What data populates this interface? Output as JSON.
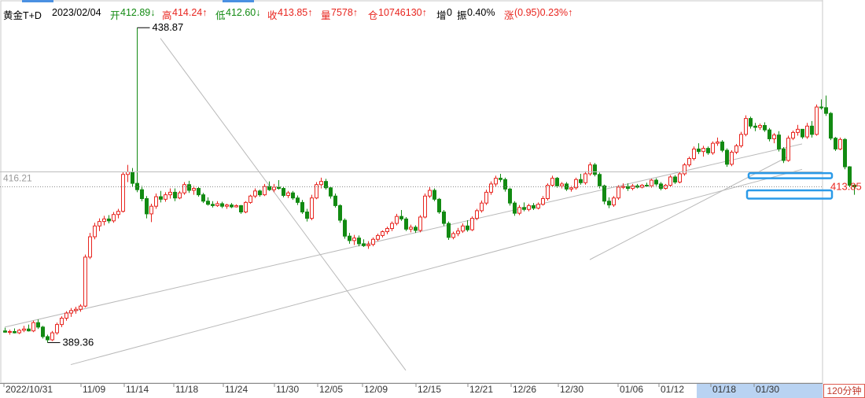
{
  "header": {
    "name": "黄金T+D",
    "date": "2023/02/04",
    "open_label": "开",
    "open": "412.89↓",
    "high_label": "高",
    "high": "414.24↑",
    "low_label": "低",
    "low": "412.60↓",
    "close_label": "收",
    "close": "413.85↑",
    "volume_label": "量",
    "volume": "7578↑",
    "oi_label": "仓",
    "oi": "10746130↑",
    "increase_label": "增",
    "increase": "0",
    "amplitude_label": "振",
    "amplitude": "0.40%",
    "change_label": "涨",
    "change": "(0.95)0.23%↑"
  },
  "period_button": "120分钟",
  "colors": {
    "up": "#e8251f",
    "down": "#128a12",
    "channel": "#b9b9b9",
    "highlight_box": "#2b9ae8",
    "axis_bg": "#b9d3f2",
    "header_red": "#e8251f",
    "header_green": "#128a12"
  },
  "chart_data": {
    "type": "candlestick",
    "title": "黄金T+D",
    "interval": "120分钟",
    "ylim": [
      383,
      441
    ],
    "x_tick_labels": [
      "2022/10/31",
      "11/09",
      "11/14",
      "11/18",
      "11/24",
      "11/30",
      "12/05",
      "12/09",
      "12/15",
      "12/21",
      "12/26",
      "12/30",
      "01/06",
      "01/12",
      "01/18",
      "01/30"
    ],
    "annotations": {
      "max": "438.87",
      "min": "389.36",
      "crosshair_price": "416.21",
      "last_price": "413.85"
    },
    "trend_lines": [
      {
        "name": "channel-upper",
        "from": [
          0,
          391.8
        ],
        "to": [
          169,
          420.6
        ]
      },
      {
        "name": "channel-lower",
        "from": [
          14,
          385.9
        ],
        "to": [
          169,
          416.6
        ]
      },
      {
        "name": "channel-inner",
        "from": [
          124,
          402.4
        ],
        "to": [
          166,
          418.6
        ]
      },
      {
        "name": "descending-line",
        "from": [
          33,
          437.2
        ],
        "to": [
          85,
          385.0
        ]
      }
    ],
    "highlight_zones": [
      {
        "name": "upper-box",
        "price_low": 415.2,
        "price_high": 416.0
      },
      {
        "name": "lower-box",
        "price_low": 412.0,
        "price_high": 413.3
      }
    ],
    "candles": [
      [
        391.2,
        391.7,
        390.9,
        391.0
      ],
      [
        391.0,
        391.4,
        390.6,
        391.1
      ],
      [
        391.1,
        391.6,
        390.8,
        390.9
      ],
      [
        390.9,
        391.5,
        390.7,
        391.3
      ],
      [
        391.3,
        392.0,
        391.0,
        391.5
      ],
      [
        391.5,
        392.2,
        391.1,
        391.2
      ],
      [
        391.2,
        392.8,
        391.0,
        392.5
      ],
      [
        392.5,
        393.0,
        391.5,
        391.8
      ],
      [
        391.8,
        392.0,
        390.0,
        390.3
      ],
      [
        390.3,
        390.6,
        389.36,
        389.8
      ],
      [
        389.8,
        391.2,
        389.6,
        390.9
      ],
      [
        390.9,
        392.5,
        390.6,
        392.2
      ],
      [
        392.2,
        393.5,
        391.8,
        393.2
      ],
      [
        393.2,
        394.3,
        392.8,
        394.0
      ],
      [
        394.0,
        394.8,
        393.4,
        394.4
      ],
      [
        394.4,
        395.0,
        393.9,
        394.6
      ],
      [
        394.6,
        395.4,
        394.2,
        395.1
      ],
      [
        395.1,
        403.2,
        394.9,
        402.8
      ],
      [
        402.8,
        406.6,
        402.5,
        406.0
      ],
      [
        406.0,
        408.2,
        405.6,
        407.7
      ],
      [
        407.7,
        408.9,
        406.9,
        408.4
      ],
      [
        408.4,
        409.3,
        407.8,
        408.8
      ],
      [
        408.8,
        409.4,
        408.1,
        408.5
      ],
      [
        408.5,
        409.9,
        408.2,
        409.5
      ],
      [
        409.5,
        410.4,
        408.9,
        410.0
      ],
      [
        410.0,
        416.2,
        409.8,
        415.8
      ],
      [
        415.8,
        417.3,
        414.6,
        416.2
      ],
      [
        416.2,
        416.8,
        413.9,
        414.4
      ],
      [
        414.4,
        438.87,
        413.0,
        413.4
      ],
      [
        413.4,
        414.0,
        411.6,
        412.0
      ],
      [
        412.0,
        412.4,
        408.9,
        409.6
      ],
      [
        409.6,
        411.2,
        408.3,
        410.8
      ],
      [
        410.8,
        412.8,
        410.4,
        412.3
      ],
      [
        412.3,
        413.2,
        411.4,
        411.9
      ],
      [
        411.9,
        413.0,
        411.5,
        412.6
      ],
      [
        412.6,
        413.6,
        412.0,
        413.0
      ],
      [
        413.0,
        413.6,
        411.6,
        412.1
      ],
      [
        412.1,
        413.2,
        411.9,
        412.9
      ],
      [
        412.9,
        414.6,
        412.6,
        414.2
      ],
      [
        414.2,
        414.8,
        412.9,
        413.3
      ],
      [
        413.3,
        414.0,
        412.6,
        413.6
      ],
      [
        413.6,
        413.9,
        412.3,
        412.6
      ],
      [
        412.6,
        412.9,
        411.3,
        411.6
      ],
      [
        411.6,
        412.2,
        410.9,
        411.1
      ],
      [
        411.1,
        411.6,
        410.6,
        410.9
      ],
      [
        410.9,
        411.6,
        410.7,
        411.2
      ],
      [
        411.2,
        411.5,
        410.5,
        410.8
      ],
      [
        410.8,
        411.2,
        410.4,
        411.0
      ],
      [
        411.0,
        411.3,
        410.5,
        410.7
      ],
      [
        410.7,
        411.1,
        410.6,
        410.9
      ],
      [
        410.9,
        411.0,
        409.6,
        409.9
      ],
      [
        409.9,
        411.6,
        409.7,
        411.4
      ],
      [
        411.4,
        412.6,
        411.2,
        412.4
      ],
      [
        412.4,
        413.6,
        412.1,
        413.2
      ],
      [
        413.2,
        413.4,
        412.3,
        412.6
      ],
      [
        412.6,
        414.3,
        412.4,
        413.9
      ],
      [
        413.9,
        414.7,
        413.2,
        413.4
      ],
      [
        413.4,
        414.3,
        413.0,
        413.8
      ],
      [
        413.8,
        414.9,
        413.4,
        413.6
      ],
      [
        413.6,
        413.8,
        412.2,
        412.5
      ],
      [
        412.5,
        413.2,
        412.1,
        412.9
      ],
      [
        412.9,
        413.2,
        411.8,
        412.1
      ],
      [
        412.1,
        412.5,
        411.0,
        411.4
      ],
      [
        411.4,
        411.8,
        409.6,
        409.9
      ],
      [
        409.9,
        410.4,
        408.4,
        408.9
      ],
      [
        408.9,
        412.6,
        408.6,
        412.1
      ],
      [
        412.1,
        414.6,
        411.9,
        414.2
      ],
      [
        414.2,
        415.3,
        413.6,
        414.7
      ],
      [
        414.7,
        415.1,
        413.4,
        413.7
      ],
      [
        413.7,
        413.9,
        412.0,
        412.4
      ],
      [
        412.4,
        412.8,
        410.6,
        410.9
      ],
      [
        410.9,
        411.1,
        408.2,
        408.6
      ],
      [
        408.6,
        408.9,
        405.7,
        406.1
      ],
      [
        406.1,
        406.6,
        404.9,
        405.4
      ],
      [
        405.4,
        406.3,
        404.7,
        405.8
      ],
      [
        405.8,
        406.2,
        404.5,
        404.9
      ],
      [
        404.9,
        405.6,
        404.4,
        404.6
      ],
      [
        404.6,
        405.3,
        404.1,
        404.8
      ],
      [
        404.8,
        405.9,
        404.5,
        405.6
      ],
      [
        405.6,
        406.5,
        405.3,
        406.2
      ],
      [
        406.2,
        407.0,
        405.9,
        406.8
      ],
      [
        406.8,
        407.6,
        406.4,
        407.3
      ],
      [
        407.3,
        408.4,
        406.9,
        408.1
      ],
      [
        408.1,
        409.6,
        407.8,
        409.2
      ],
      [
        409.2,
        410.2,
        408.5,
        408.8
      ],
      [
        408.8,
        409.1,
        406.9,
        407.2
      ],
      [
        407.2,
        407.9,
        406.7,
        407.5
      ],
      [
        407.5,
        407.8,
        406.6,
        407.0
      ],
      [
        407.0,
        409.4,
        406.7,
        409.1
      ],
      [
        409.1,
        412.8,
        408.9,
        412.4
      ],
      [
        412.4,
        413.9,
        412.1,
        413.3
      ],
      [
        413.3,
        413.6,
        411.6,
        411.9
      ],
      [
        411.9,
        412.1,
        409.6,
        409.9
      ],
      [
        409.9,
        410.2,
        407.7,
        408.1
      ],
      [
        408.1,
        408.4,
        405.5,
        405.9
      ],
      [
        405.9,
        406.8,
        405.6,
        406.5
      ],
      [
        406.5,
        407.4,
        406.1,
        406.9
      ],
      [
        406.9,
        408.1,
        406.6,
        407.7
      ],
      [
        407.7,
        408.6,
        406.8,
        407.1
      ],
      [
        407.1,
        409.2,
        406.9,
        408.9
      ],
      [
        408.9,
        410.4,
        408.6,
        410.1
      ],
      [
        410.1,
        411.7,
        409.8,
        411.3
      ],
      [
        411.3,
        413.4,
        411.0,
        413.0
      ],
      [
        413.0,
        414.7,
        412.6,
        414.3
      ],
      [
        414.3,
        415.6,
        413.9,
        415.2
      ],
      [
        415.2,
        415.9,
        414.6,
        415.0
      ],
      [
        415.0,
        415.3,
        413.1,
        413.5
      ],
      [
        413.5,
        413.7,
        410.9,
        411.3
      ],
      [
        411.3,
        411.6,
        409.3,
        409.7
      ],
      [
        409.7,
        411.0,
        409.4,
        410.6
      ],
      [
        410.6,
        411.4,
        410.0,
        410.3
      ],
      [
        410.3,
        411.2,
        410.0,
        410.9
      ],
      [
        410.9,
        411.3,
        410.2,
        410.5
      ],
      [
        410.5,
        411.4,
        410.3,
        411.1
      ],
      [
        411.1,
        412.4,
        410.9,
        412.0
      ],
      [
        412.0,
        414.4,
        411.7,
        414.1
      ],
      [
        414.1,
        415.6,
        413.8,
        415.2
      ],
      [
        415.2,
        415.4,
        413.7,
        414.0
      ],
      [
        414.0,
        414.6,
        413.6,
        414.3
      ],
      [
        414.3,
        414.6,
        413.2,
        413.5
      ],
      [
        413.5,
        414.0,
        413.1,
        413.7
      ],
      [
        413.7,
        415.3,
        413.4,
        415.0
      ],
      [
        415.0,
        415.9,
        414.2,
        414.5
      ],
      [
        414.5,
        416.3,
        414.2,
        415.9
      ],
      [
        415.9,
        417.7,
        415.6,
        417.3
      ],
      [
        417.3,
        417.6,
        415.5,
        415.8
      ],
      [
        415.8,
        416.1,
        413.6,
        414.0
      ],
      [
        414.0,
        414.2,
        411.1,
        411.6
      ],
      [
        411.6,
        412.2,
        410.5,
        411.0
      ],
      [
        411.0,
        412.4,
        410.7,
        412.1
      ],
      [
        412.1,
        414.1,
        411.8,
        413.8
      ],
      [
        413.8,
        414.4,
        413.5,
        413.9
      ],
      [
        413.9,
        414.4,
        413.2,
        413.6
      ],
      [
        413.6,
        414.3,
        413.3,
        414.0
      ],
      [
        414.0,
        414.3,
        413.6,
        413.8
      ],
      [
        413.8,
        414.3,
        413.6,
        414.1
      ],
      [
        414.1,
        414.5,
        413.8,
        414.0
      ],
      [
        414.0,
        415.1,
        413.7,
        414.9
      ],
      [
        414.9,
        415.2,
        414.0,
        414.3
      ],
      [
        414.3,
        414.6,
        413.3,
        413.6
      ],
      [
        413.6,
        414.3,
        413.4,
        414.1
      ],
      [
        414.1,
        415.7,
        413.9,
        415.4
      ],
      [
        415.4,
        415.7,
        414.3,
        414.6
      ],
      [
        414.6,
        416.2,
        414.4,
        415.9
      ],
      [
        415.9,
        417.6,
        415.6,
        417.3
      ],
      [
        417.3,
        418.6,
        417.0,
        418.3
      ],
      [
        418.3,
        420.2,
        418.0,
        419.8
      ],
      [
        419.8,
        420.7,
        419.0,
        419.4
      ],
      [
        419.4,
        420.3,
        418.6,
        419.9
      ],
      [
        419.9,
        420.2,
        418.9,
        419.2
      ],
      [
        419.2,
        421.0,
        418.9,
        420.7
      ],
      [
        420.7,
        421.6,
        420.3,
        420.9
      ],
      [
        420.9,
        421.2,
        419.3,
        419.6
      ],
      [
        419.6,
        419.9,
        417.0,
        417.4
      ],
      [
        417.4,
        419.6,
        417.1,
        419.3
      ],
      [
        419.3,
        420.6,
        419.0,
        420.3
      ],
      [
        420.3,
        422.5,
        420.0,
        422.1
      ],
      [
        422.1,
        425.1,
        421.8,
        424.6
      ],
      [
        424.6,
        424.9,
        423.0,
        423.4
      ],
      [
        423.4,
        423.9,
        422.6,
        423.2
      ],
      [
        423.2,
        423.8,
        422.8,
        423.5
      ],
      [
        423.5,
        424.0,
        422.5,
        422.8
      ],
      [
        422.8,
        423.1,
        421.0,
        421.4
      ],
      [
        421.4,
        422.3,
        420.7,
        422.0
      ],
      [
        422.0,
        422.6,
        419.4,
        419.8
      ],
      [
        419.8,
        420.1,
        417.6,
        418.0
      ],
      [
        418.0,
        421.9,
        417.8,
        421.5
      ],
      [
        421.5,
        422.7,
        421.2,
        422.4
      ],
      [
        422.4,
        423.6,
        421.9,
        422.9
      ],
      [
        422.9,
        422.9,
        421.4,
        421.7
      ],
      [
        421.7,
        423.9,
        421.4,
        423.4
      ],
      [
        423.4,
        424.2,
        421.6,
        422.1
      ],
      [
        422.1,
        426.8,
        421.9,
        426.4
      ],
      [
        426.4,
        427.6,
        426.0,
        426.3
      ],
      [
        426.3,
        428.2,
        425.0,
        425.4
      ],
      [
        425.4,
        425.6,
        421.2,
        421.5
      ],
      [
        421.5,
        421.7,
        419.5,
        419.8
      ],
      [
        419.8,
        421.6,
        419.6,
        421.3
      ],
      [
        421.3,
        421.5,
        416.6,
        417.0
      ],
      [
        417.0,
        417.1,
        413.8,
        414.1
      ],
      [
        414.1,
        414.24,
        412.6,
        413.85
      ]
    ]
  }
}
